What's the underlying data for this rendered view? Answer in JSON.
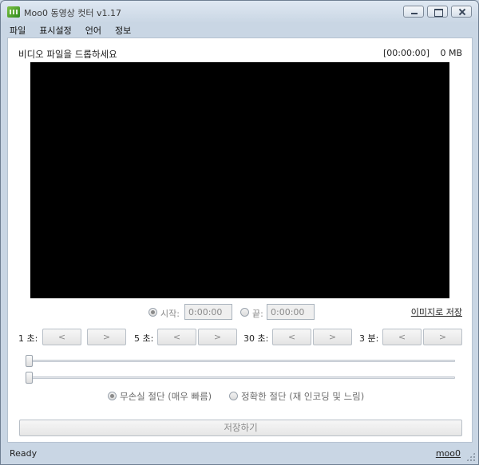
{
  "window": {
    "title": "Moo0 동영상 컷터 v1.17"
  },
  "menu": {
    "items": [
      "파일",
      "표시설정",
      "언어",
      "정보"
    ]
  },
  "video": {
    "hint": "비디오 파일을 드롭하세요",
    "timecode": "[00:00:00]",
    "size": "0 MB"
  },
  "range": {
    "start_label": "시작:",
    "start_value": "0:00:00",
    "end_label": "끝:",
    "end_value": "0:00:00",
    "start_selected": true,
    "save_image_label": "이미지로 저장"
  },
  "steps": [
    {
      "label": "1 초:",
      "back": "<",
      "forward": ">"
    },
    {
      "label": "5 초:",
      "back": "<",
      "forward": ">"
    },
    {
      "label": "30 초:",
      "back": "<",
      "forward": ">"
    },
    {
      "label": "3 분:",
      "back": "<",
      "forward": ">"
    }
  ],
  "sliders": {
    "start_position": 0,
    "end_position": 0
  },
  "cut_mode": {
    "lossless": "무손실 절단 (매우 빠름)",
    "accurate": "정확한 절단 (재 인코딩 및 느림)",
    "selected": "lossless"
  },
  "save_button": "저장하기",
  "status": {
    "text": "Ready",
    "link": "moo0"
  },
  "colors": {
    "video_background": "#000000",
    "disabled_text": "#8a8a8a"
  }
}
